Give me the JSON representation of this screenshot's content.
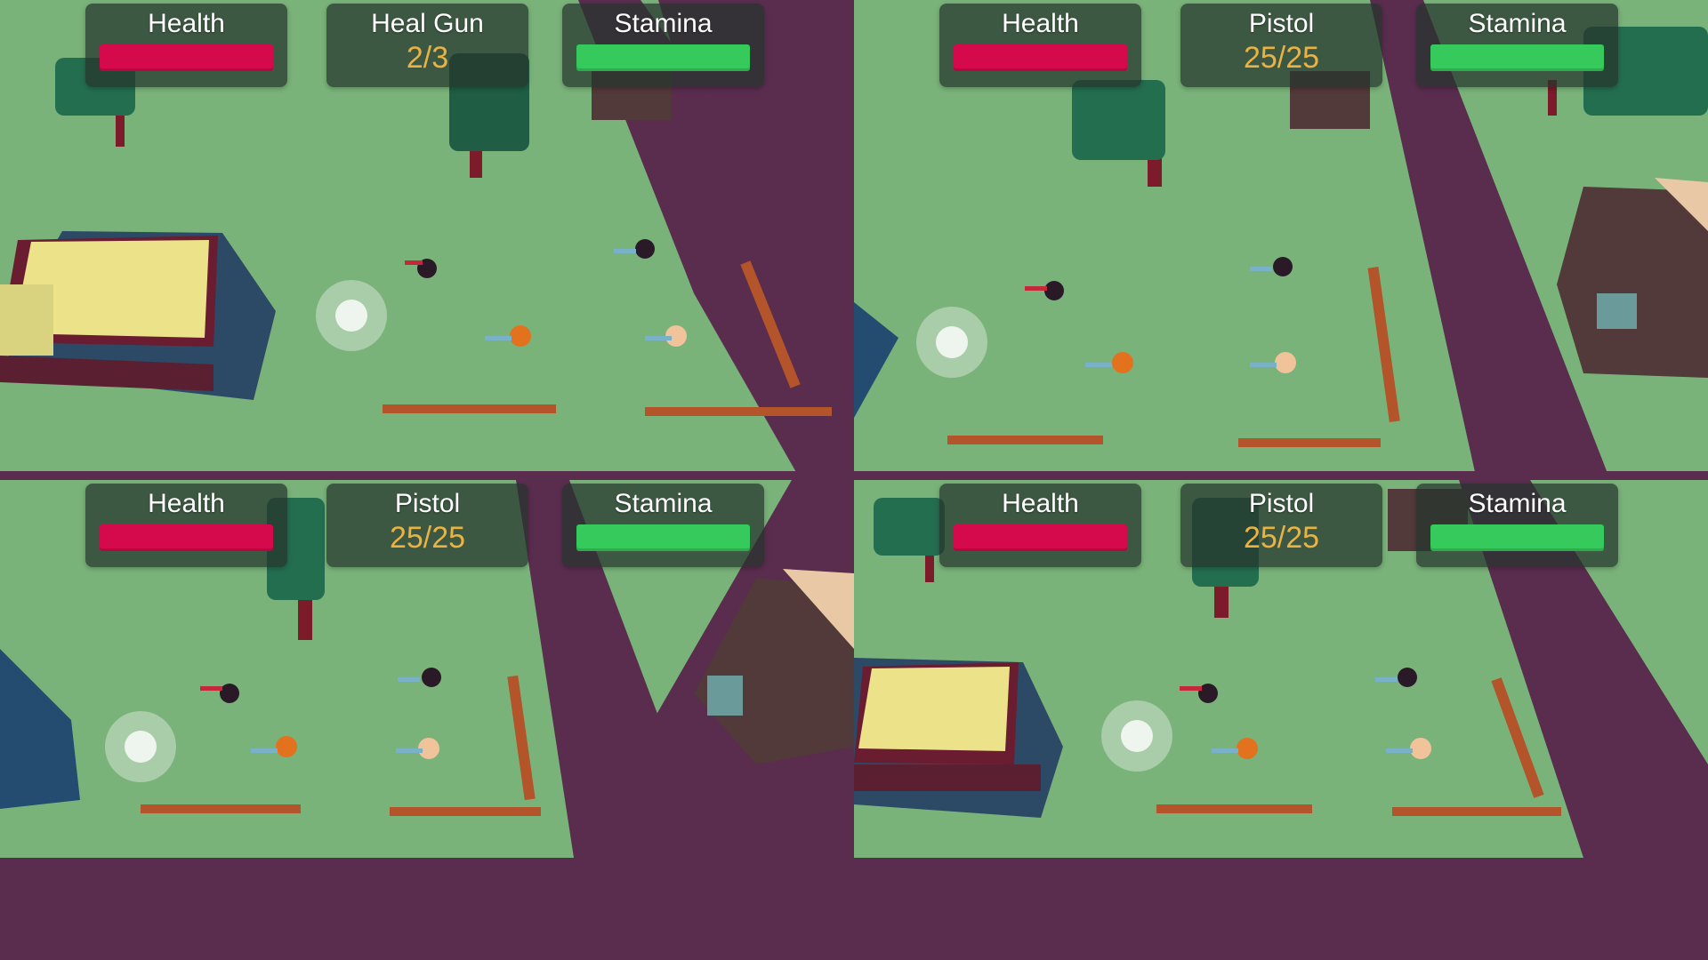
{
  "colors": {
    "grass": "#7ab37a",
    "road": "#5a2d4f",
    "health_bar": "#d50a4c",
    "stamina_bar": "#36c95b",
    "ammo_text": "#e9b243"
  },
  "players": [
    {
      "health_label": "Health",
      "weapon_label": "Heal Gun",
      "weapon_ammo": "2/3",
      "stamina_label": "Stamina",
      "health_fraction": 1.0,
      "stamina_fraction": 1.0
    },
    {
      "health_label": "Health",
      "weapon_label": "Pistol",
      "weapon_ammo": "25/25",
      "stamina_label": "Stamina",
      "health_fraction": 1.0,
      "stamina_fraction": 1.0
    },
    {
      "health_label": "Health",
      "weapon_label": "Pistol",
      "weapon_ammo": "25/25",
      "stamina_label": "Stamina",
      "health_fraction": 1.0,
      "stamina_fraction": 1.0
    },
    {
      "health_label": "Health",
      "weapon_label": "Pistol",
      "weapon_ammo": "25/25",
      "stamina_label": "Stamina",
      "health_fraction": 1.0,
      "stamina_fraction": 1.0
    }
  ]
}
